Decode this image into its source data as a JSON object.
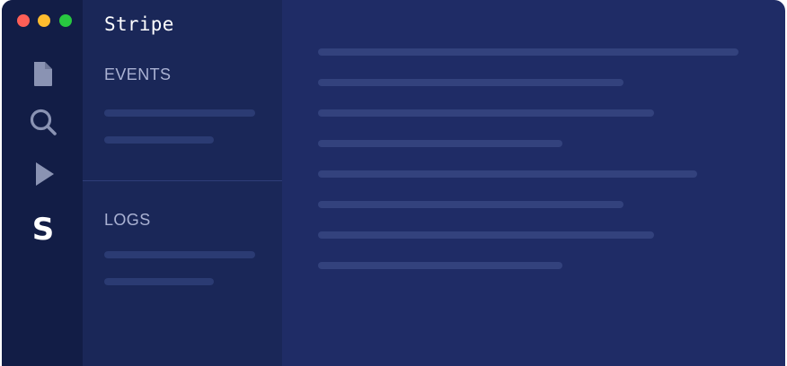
{
  "window": {
    "traffic_lights": [
      "close",
      "minimize",
      "zoom"
    ],
    "colors": {
      "close": "#fe5f57",
      "minimize": "#febc2e",
      "zoom": "#28c840"
    }
  },
  "activity_bar": {
    "icons": [
      "file-icon",
      "search-icon",
      "run-icon",
      "stripe-icon"
    ],
    "stripe_glyph": "S"
  },
  "sidebar": {
    "title": "Stripe",
    "sections": [
      {
        "label": "EVENTS"
      },
      {
        "label": "LOGS"
      }
    ]
  },
  "theme": {
    "background": "#1f2c66",
    "activity_bar_bg": "#121d46",
    "sidebar_bg": "#1a2758",
    "text_muted": "#aab2d3"
  }
}
